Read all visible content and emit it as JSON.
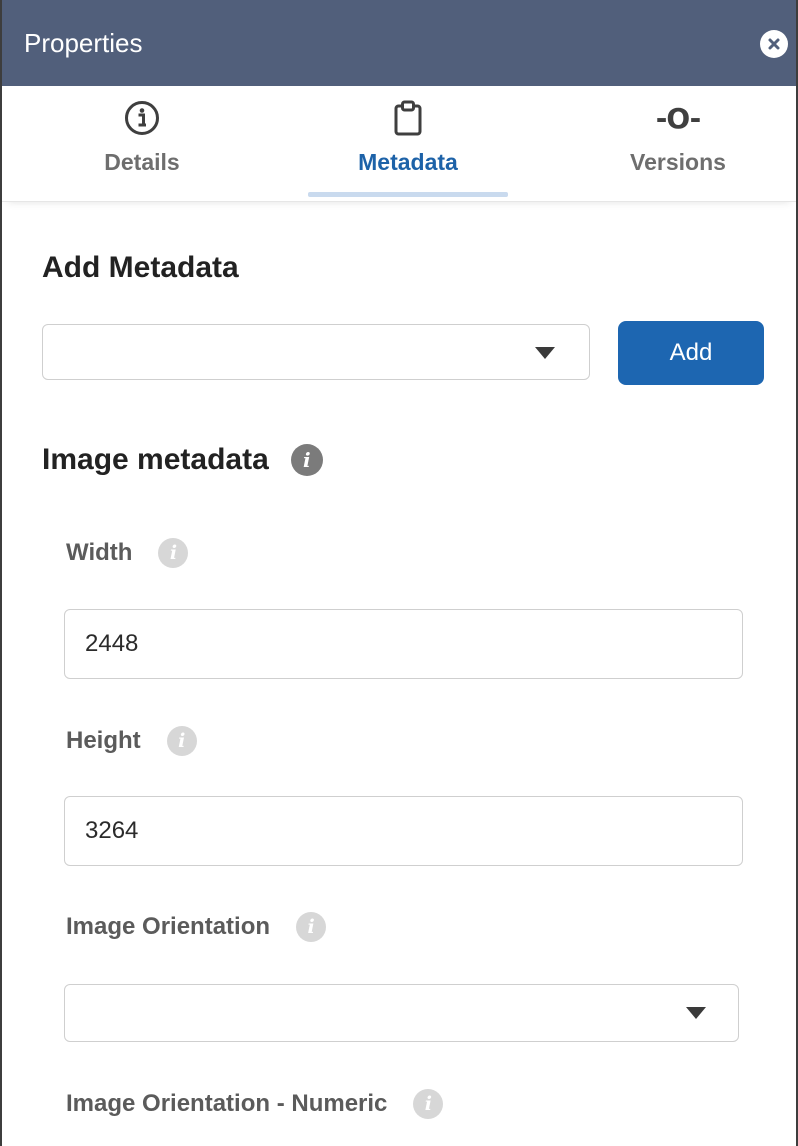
{
  "titlebar": {
    "title": "Properties"
  },
  "tabs": [
    {
      "label": "Details",
      "icon": "info-circle-icon"
    },
    {
      "label": "Metadata",
      "icon": "clipboard-icon",
      "active": true
    },
    {
      "label": "Versions",
      "icon": "version-node-icon",
      "glyph": "-O-"
    }
  ],
  "add_metadata": {
    "heading": "Add Metadata",
    "select_value": "",
    "add_label": "Add"
  },
  "image_metadata": {
    "heading": "Image metadata",
    "fields": [
      {
        "label": "Width",
        "value": "2448"
      },
      {
        "label": "Height",
        "value": "3264"
      },
      {
        "label": "Image Orientation",
        "value": ""
      },
      {
        "label": "Image Orientation - Numeric"
      }
    ]
  },
  "colors": {
    "titlebar_bg": "#515f7b",
    "accent": "#1d62a8",
    "button_bg": "#1d66b1"
  }
}
